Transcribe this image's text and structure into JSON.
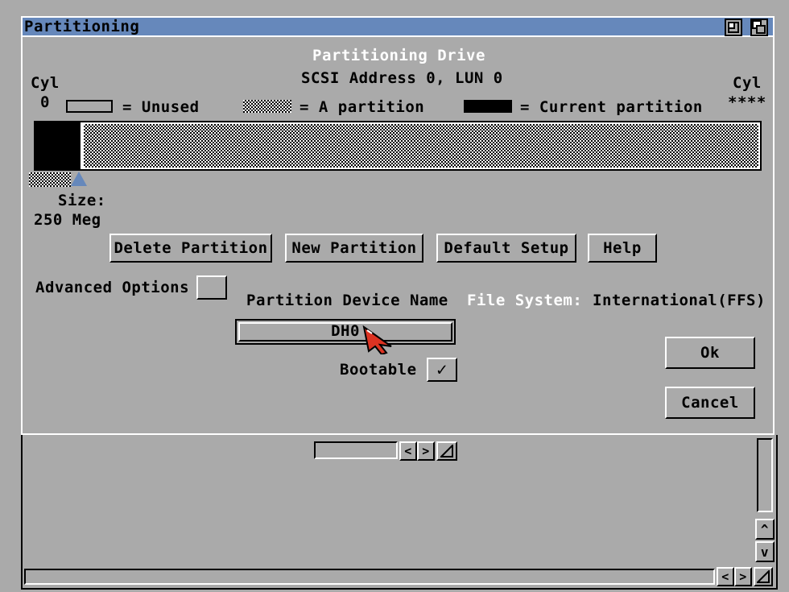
{
  "window": {
    "title": "Partitioning"
  },
  "header": {
    "title": "Partitioning Drive",
    "address": "SCSI Address 0, LUN 0",
    "cyl_left_label": "Cyl",
    "cyl_left_value": "0",
    "cyl_right_label": "Cyl",
    "cyl_right_value": "****"
  },
  "legend": {
    "unused": "= Unused",
    "a_partition": "= A partition",
    "current_partition": "= Current partition"
  },
  "partition_size": {
    "label": "Size:",
    "value": "250 Meg"
  },
  "buttons": {
    "delete_partition": "Delete Partition",
    "new_partition": "New Partition",
    "default_setup": "Default Setup",
    "help": "Help",
    "ok": "Ok",
    "cancel": "Cancel"
  },
  "advanced_options": {
    "label": "Advanced Options",
    "checked": false
  },
  "device_name": {
    "label": "Partition Device Name",
    "value": "DH0"
  },
  "file_system": {
    "label": "File System:",
    "value": "International(FFS)"
  },
  "bootable": {
    "label": "Bootable",
    "checked": true,
    "mark": "✓"
  },
  "scroll_arrows": {
    "left": "<",
    "right": ">",
    "up": "^",
    "down": "v"
  },
  "colors": {
    "title_bar": "#6688bb",
    "background": "#aaaaaa",
    "highlight": "#ffffff",
    "pointer": "#dd3322"
  },
  "icons": [
    "zoom-gadget-icon",
    "depth-gadget-icon",
    "size-gadget-icon",
    "mouse-pointer-icon"
  ]
}
